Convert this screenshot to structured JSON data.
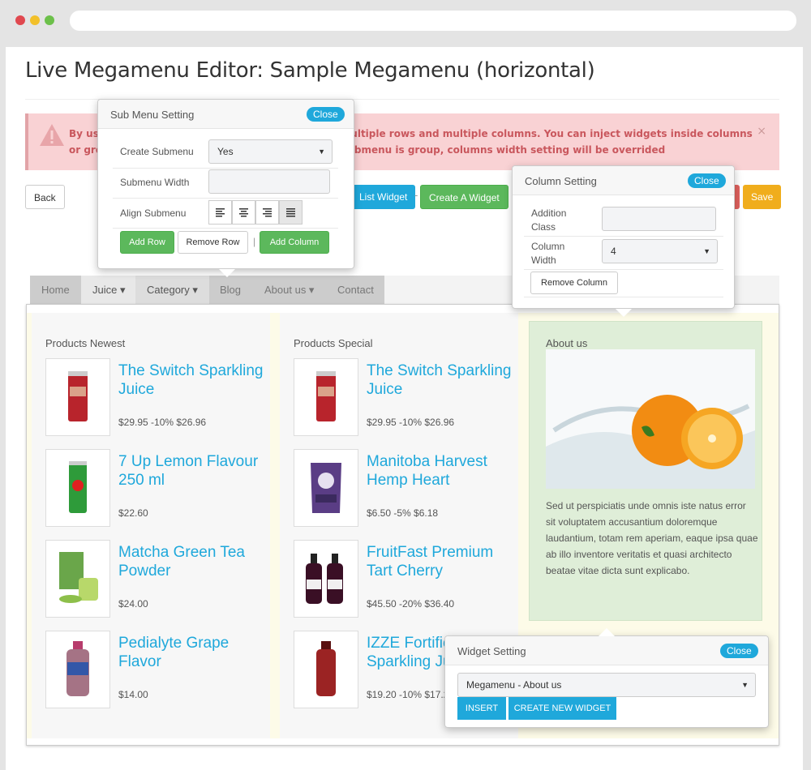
{
  "page": {
    "title": "Live Megamenu Editor: Sample Megamenu (horizontal)"
  },
  "alert": {
    "text": "By using this tool, you can build megamenu with multiple rows and multiple columns. You can inject widgets inside columns or group sub menus in same column. Note: when submenu is group, columns width setting will be overrided",
    "close": "×"
  },
  "toolbar": {
    "back": "Back",
    "list_widget": "List Widget",
    "create_widget": "Create A Widget",
    "save": "Save",
    "separator": "-"
  },
  "menu": {
    "items": [
      {
        "label": "Home"
      },
      {
        "label": "Juice ▾"
      },
      {
        "label": "Category ▾"
      },
      {
        "label": "Blog"
      },
      {
        "label": "About us ▾"
      },
      {
        "label": "Contact"
      }
    ]
  },
  "columns": {
    "col1": {
      "title": "Products Newest",
      "products": [
        {
          "name": "The Switch Sparkling Juice",
          "price": "$29.95 -10% $26.96"
        },
        {
          "name": "7 Up Lemon Flavour 250 ml",
          "price": "$22.60"
        },
        {
          "name": "Matcha Green Tea Powder",
          "price": "$24.00"
        },
        {
          "name": "Pedialyte Grape Flavor",
          "price": "$14.00"
        }
      ]
    },
    "col2": {
      "title": "Products Special",
      "products": [
        {
          "name": "The Switch Sparkling Juice",
          "price": "$29.95 -10% $26.96"
        },
        {
          "name": "Manitoba Harvest Hemp Heart",
          "price": "$6.50 -5% $6.18"
        },
        {
          "name": "FruitFast Premium Tart Cherry",
          "price": "$45.50 -20% $36.40"
        },
        {
          "name": "IZZE Fortified Sparkling Juice",
          "price": "$19.20 -10% $17.28"
        }
      ]
    },
    "col3": {
      "title": "About us",
      "text": "Sed ut perspiciatis unde omnis iste natus error sit voluptatem accusantium doloremque laudantium, totam rem aperiam, eaque ipsa quae ab illo inventore veritatis et quasi architecto beatae vitae dicta sunt explicabo."
    }
  },
  "submenu_setting": {
    "title": "Sub Menu Setting",
    "close": "Close",
    "create_label": "Create Submenu",
    "create_value": "Yes",
    "width_label": "Submenu Width",
    "width_value": "",
    "align_label": "Align Submenu",
    "add_row": "Add Row",
    "remove_row": "Remove Row",
    "divider": "|",
    "add_column": "Add Column"
  },
  "column_setting": {
    "title": "Column Setting",
    "close": "Close",
    "class_label": "Addition Class",
    "class_value": "",
    "width_label": "Column Width",
    "width_value": "4",
    "remove_column": "Remove Column"
  },
  "widget_setting": {
    "title": "Widget Setting",
    "close": "Close",
    "selected": "Megamenu - About us",
    "insert": "INSERT",
    "create_new": "CREATE NEW WIDGET"
  },
  "colors": {
    "accent_blue": "#1fa8db",
    "green": "#5cb85c",
    "orange": "#f0ad1c",
    "alert_bg": "#f9d2d4",
    "alert_text": "#c9575d"
  }
}
